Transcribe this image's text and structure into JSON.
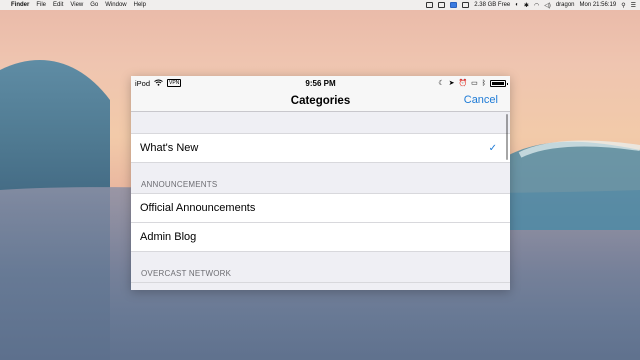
{
  "menubar": {
    "apple": "",
    "app_name": "Finder",
    "menus": [
      "File",
      "Edit",
      "View",
      "Go",
      "Window",
      "Help"
    ],
    "disk_info": "2.38 GB Free",
    "user": "dragon",
    "clock": "Mon 21:56:19"
  },
  "ios": {
    "status": {
      "carrier": "iPod",
      "vpn": "VPN",
      "time": "9:56 PM"
    },
    "nav": {
      "title": "Categories",
      "cancel": "Cancel"
    },
    "rows": [
      {
        "type": "cell",
        "label": "What's New",
        "checked": true
      },
      {
        "type": "header",
        "label": "ANNOUNCEMENTS"
      },
      {
        "type": "cell",
        "label": "Official Announcements",
        "checked": false
      },
      {
        "type": "cell",
        "label": "Admin Blog",
        "checked": false
      },
      {
        "type": "header",
        "label": "OVERCAST NETWORK"
      }
    ],
    "accent": "#1e7bd6"
  }
}
